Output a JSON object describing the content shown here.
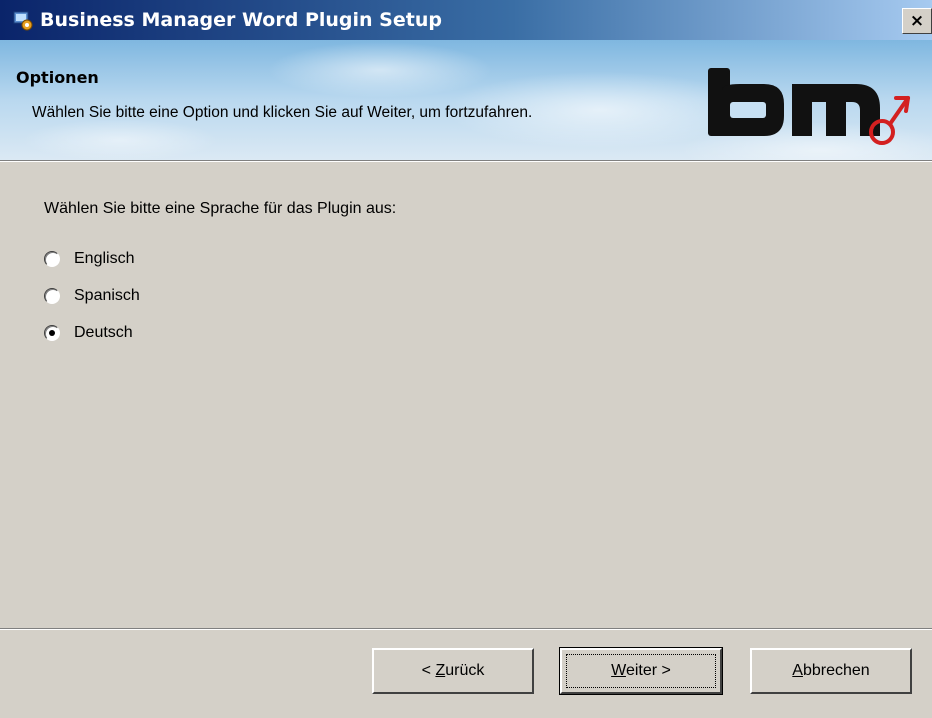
{
  "window": {
    "title": "Business Manager Word Plugin Setup",
    "close_label": "×"
  },
  "banner": {
    "heading": "Optionen",
    "subtitle": "Wählen Sie bitte eine Option und klicken Sie auf Weiter, um fortzufahren.",
    "logo": {
      "text": "bm",
      "accent_color": "#d32020"
    }
  },
  "main": {
    "prompt": "Wählen Sie bitte eine Sprache für das Plugin aus:",
    "language_options": [
      {
        "label": "Englisch",
        "selected": false
      },
      {
        "label": "Spanisch",
        "selected": false
      },
      {
        "label": "Deutsch",
        "selected": true
      }
    ]
  },
  "footer": {
    "back_button": {
      "prefix": "< ",
      "mnemonic": "Z",
      "rest": "urück"
    },
    "next_button": {
      "mnemonic": "W",
      "rest": "eiter >"
    },
    "cancel_button": {
      "mnemonic": "A",
      "rest": "bbrechen"
    }
  },
  "colors": {
    "titlebar_start": "#0a246a",
    "titlebar_end": "#a6caf0",
    "dialog_face": "#d4d0c8",
    "logo_accent": "#d32020"
  },
  "icons": {
    "titlebar": "setup-installer-icon"
  }
}
